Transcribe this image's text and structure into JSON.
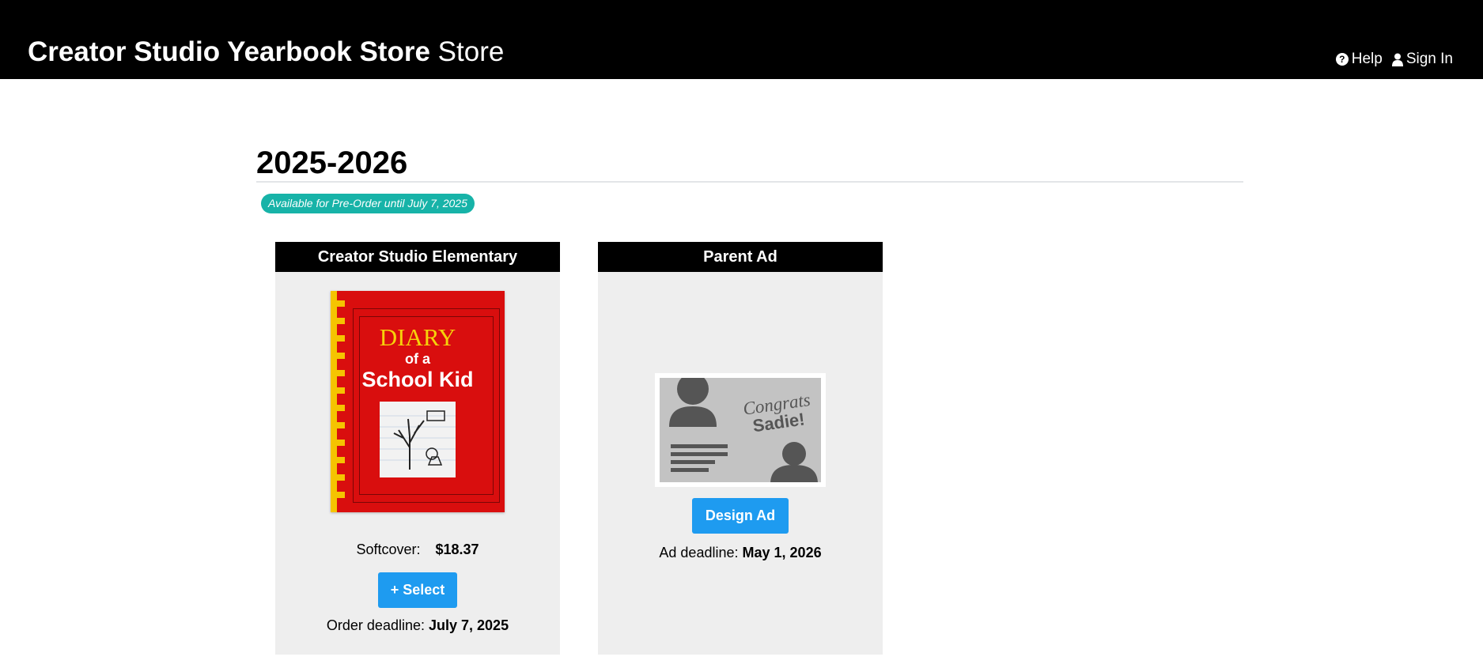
{
  "header": {
    "brand_bold": "Creator Studio Yearbook Store",
    "brand_light": "Store",
    "help_label": "Help",
    "signin_label": "Sign In"
  },
  "section": {
    "title": "2025-2026",
    "badge": "Available for Pre-Order until July 7, 2025"
  },
  "products": [
    {
      "name": "Creator Studio Elementary",
      "cover_text_line1": "DIARY",
      "cover_text_line2": "of a",
      "cover_text_line3": "School Kid",
      "price_label": "Softcover:",
      "price_value": "$18.37",
      "button_label": "+ Select",
      "deadline_label": "Order deadline:",
      "deadline_value": "July 7, 2025"
    },
    {
      "name": "Parent Ad",
      "ad_text_line1": "Congrats",
      "ad_text_line2": "Sadie!",
      "button_label": "Design Ad",
      "deadline_label": "Ad deadline:",
      "deadline_value": "May 1, 2026"
    }
  ],
  "colors": {
    "topbar": "#000000",
    "accent_button": "#1e9bf0",
    "badge": "#17b3a8",
    "card_bg": "#eeeeee",
    "cover_red": "#d90e0e",
    "cover_yellow": "#f5c400"
  },
  "icons": {
    "help": "question-circle-icon",
    "signin": "user-icon"
  }
}
